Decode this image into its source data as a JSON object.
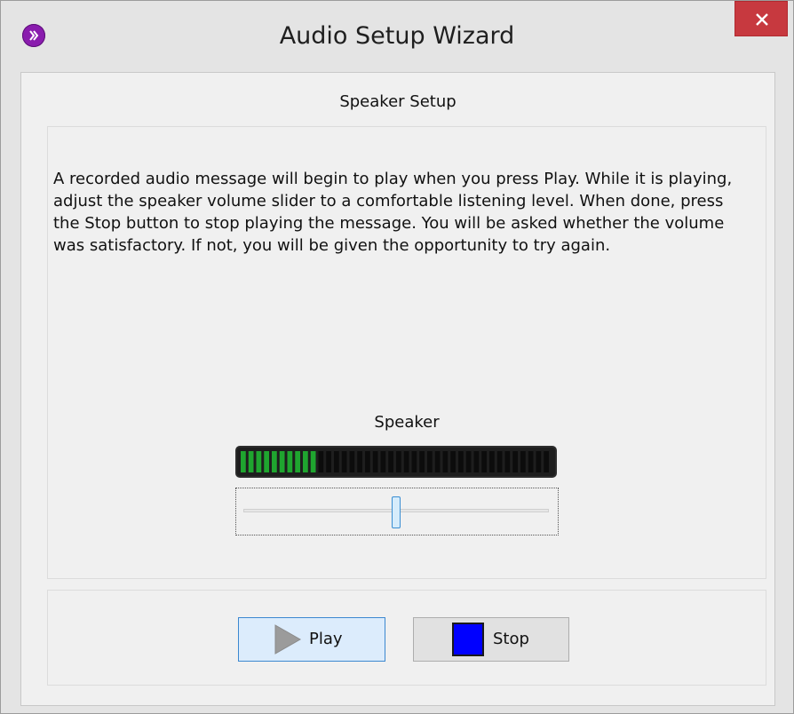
{
  "window": {
    "title": "Audio Setup Wizard",
    "icon": "chevron-circle-icon",
    "close_icon": "close-icon"
  },
  "wizard": {
    "section_title": "Speaker Setup",
    "instructions": "A recorded audio message will begin to play when you press Play. While it is playing, adjust the speaker volume slider to a comfortable listening level. When done, press the Stop button to stop playing the message. You will be asked whether the volume was satisfactory. If not, you will be given the opportunity to try again."
  },
  "speaker": {
    "label": "Speaker",
    "meter_segments_total": 40,
    "meter_segments_active": 10,
    "meter_active_color": "#1fa52f",
    "meter_inactive_color": "#0c0c0c",
    "volume_fraction": 0.5
  },
  "buttons": {
    "play_label": "Play",
    "play_icon": "play-icon",
    "stop_label": "Stop",
    "stop_icon": "stop-icon",
    "stop_color": "#0000ff"
  }
}
